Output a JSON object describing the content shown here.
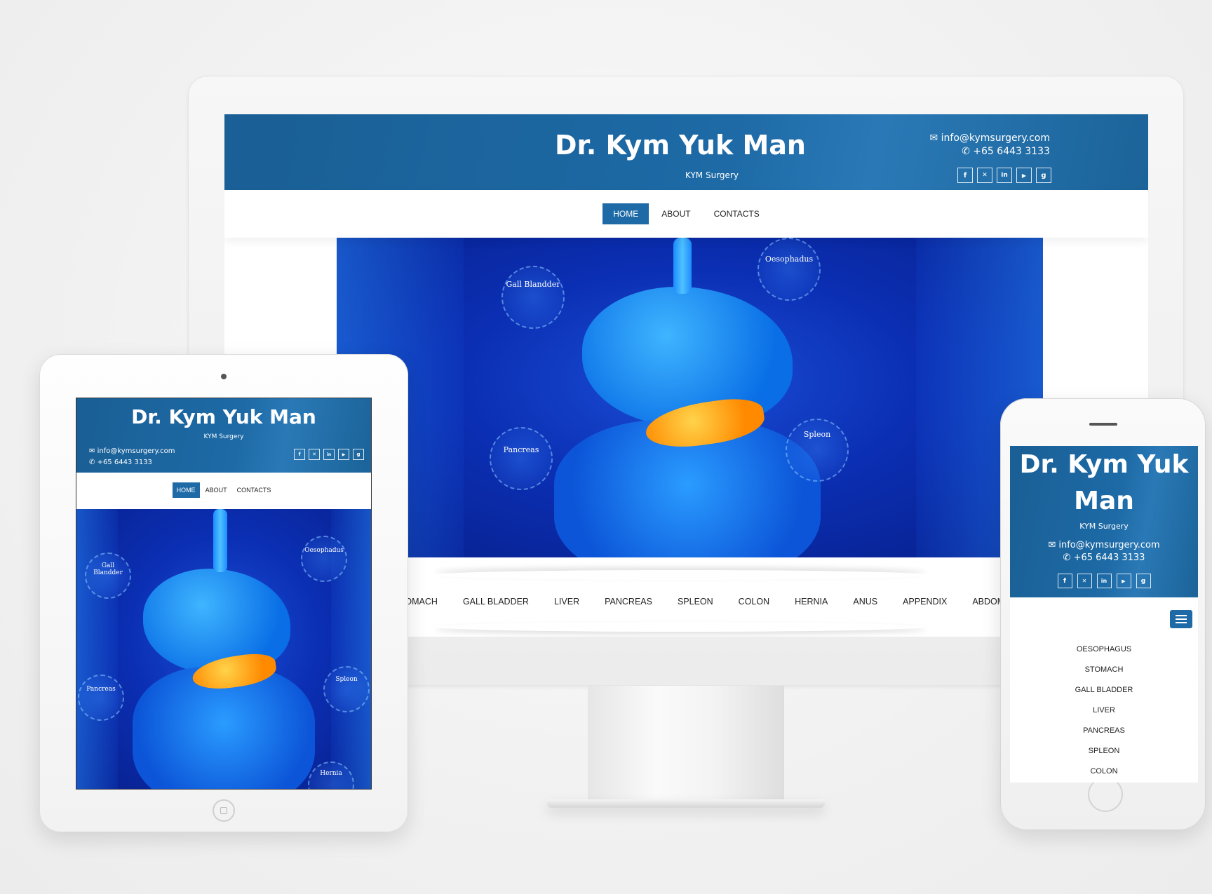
{
  "site": {
    "title": "Dr. Kym Yuk Man",
    "title_phone_line1": "Dr. Kym Yuk",
    "title_phone_line2": "Man",
    "subtitle": "KYM Surgery",
    "email": "info@kymsurgery.com",
    "phone": "+65 6443 3133",
    "header_color": "#1d6aa6",
    "social": [
      {
        "icon": "facebook-icon",
        "glyph": "f"
      },
      {
        "icon": "twitter-icon",
        "glyph": "✕"
      },
      {
        "icon": "linkedin-icon",
        "glyph": "in"
      },
      {
        "icon": "youtube-icon",
        "glyph": "▶"
      },
      {
        "icon": "googleplus-icon",
        "glyph": "g"
      }
    ]
  },
  "nav": {
    "home": "HOME",
    "about": "ABOUT",
    "contacts": "CONTACTS",
    "active": "HOME"
  },
  "hero_labels": {
    "gall_bladder": "Gall Blandder",
    "oesophagus": "Oesophadus",
    "pancreas": "Pancreas",
    "spleen": "Spleon",
    "hernia": "Hernia"
  },
  "categories": {
    "desktop": [
      "TOMACH",
      "GALL BLADDER",
      "LIVER",
      "PANCREAS",
      "SPLEON",
      "COLON",
      "HERNIA",
      "ANUS",
      "APPENDIX",
      "ABDOMINAL I"
    ],
    "phone": [
      "OESOPHAGUS",
      "STOMACH",
      "GALL BLADDER",
      "LIVER",
      "PANCREAS",
      "SPLEON",
      "COLON"
    ]
  }
}
